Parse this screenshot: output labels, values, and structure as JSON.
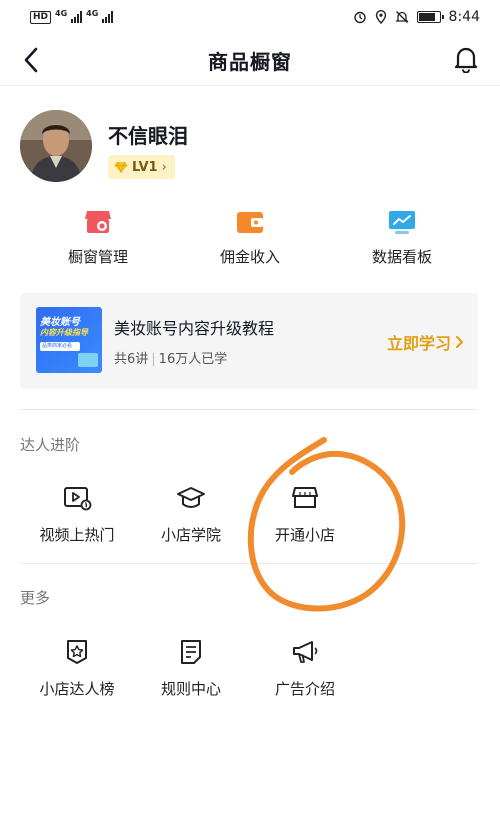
{
  "status_bar": {
    "network_badge": "HD",
    "net_type_1": "4G",
    "net_type_2": "4G",
    "time": "8:44",
    "icons": [
      "alarm-icon",
      "location-icon",
      "mute-icon",
      "battery-icon"
    ]
  },
  "nav": {
    "title": "商品橱窗",
    "back_icon": "chevron-left-icon",
    "notification_icon": "bell-icon"
  },
  "profile": {
    "name": "不信眼泪",
    "level": "LV1",
    "level_chevron": "›"
  },
  "quick_entries": [
    {
      "label": "橱窗管理",
      "icon": "shop-settings-icon"
    },
    {
      "label": "佣金收入",
      "icon": "wallet-icon"
    },
    {
      "label": "数据看板",
      "icon": "chart-board-icon"
    }
  ],
  "course": {
    "thumbnail_line1": "美妆账号",
    "thumbnail_line2": "内容升级指导",
    "thumbnail_line3": "品类商家必看",
    "title": "美妆账号内容升级教程",
    "lessons": "共6讲",
    "learners": "16万人已学",
    "cta": "立即学习",
    "cta_chevron": "›"
  },
  "sections": {
    "advance": {
      "title": "达人进阶",
      "items": [
        {
          "label": "视频上热门",
          "icon": "video-hot-icon"
        },
        {
          "label": "小店学院",
          "icon": "graduation-cap-icon"
        },
        {
          "label": "开通小店",
          "icon": "store-icon"
        }
      ]
    },
    "more": {
      "title": "更多",
      "items": [
        {
          "label": "小店达人榜",
          "icon": "star-badge-icon"
        },
        {
          "label": "规则中心",
          "icon": "rules-document-icon"
        },
        {
          "label": "广告介绍",
          "icon": "megaphone-icon"
        }
      ]
    }
  },
  "colors": {
    "accent_orange": "#f08c2e",
    "cta_gold": "#e0a014",
    "icon_red": "#f0585e",
    "icon_orange": "#f5882a",
    "icon_blue": "#2fa9e8",
    "level_badge_bg": "#fdf2c6"
  }
}
